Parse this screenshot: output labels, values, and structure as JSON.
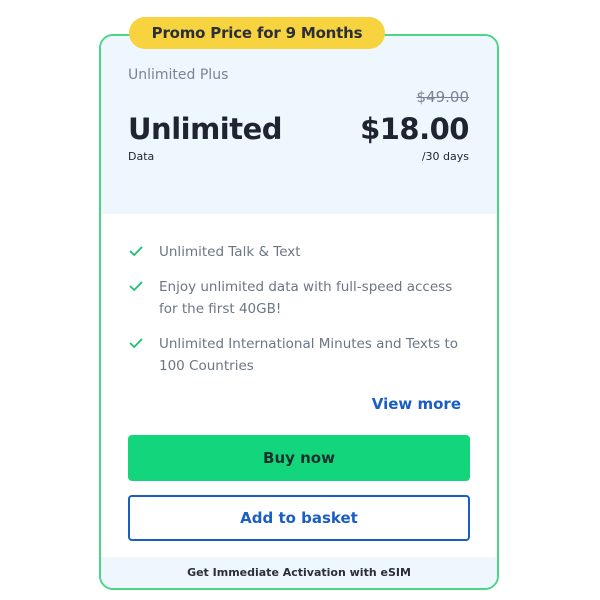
{
  "promo": {
    "badge": "Promo Price for 9 Months",
    "badge_color": "#f7d33f"
  },
  "plan": {
    "name": "Unlimited Plus",
    "title": "Unlimited",
    "subtitle": "Data",
    "old_price": "$49.00",
    "price": "$18.00",
    "period": "/30 days"
  },
  "features": [
    {
      "text": "Unlimited Talk & Text",
      "icon": "check-icon"
    },
    {
      "text": "Enjoy unlimited data with full-speed access for the first 40GB!",
      "icon": "check-icon"
    },
    {
      "text": "Unlimited International Minutes and Texts to 100 Countries",
      "icon": "check-icon"
    }
  ],
  "actions": {
    "view_more": "View more",
    "buy_now": "Buy now",
    "add_to_basket": "Add to basket"
  },
  "footer": {
    "text": "Get Immediate Activation with eSIM"
  },
  "colors": {
    "accent_green": "#13d57c",
    "card_border": "#4cd587",
    "link_blue": "#1a5ec4",
    "header_bg": "#eef6fe"
  }
}
